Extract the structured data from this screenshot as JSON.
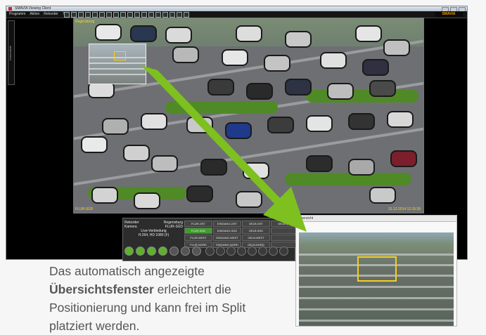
{
  "window": {
    "title": "SMAVIA Viewing Client",
    "menu": [
      "Programm",
      "Aktion",
      "Rekorder",
      "?"
    ],
    "brand": "SMAVIA",
    "side_tab": "Kameraliste"
  },
  "camera": {
    "label": "Regensburg",
    "name": "FLUR-SÜD",
    "timestamp": "31.12.2014 12:15:39"
  },
  "panel": {
    "recorder_label": "Rekorder",
    "recorder_value": "Regensburg",
    "camera_label": "Kamera",
    "camera_value": "FLUR-SÜD",
    "connection": "Live-Verbindung",
    "format": "H.264, HD 1080 (F)",
    "cameras": [
      "FLUR-OST",
      "EINGANG-OST",
      "GELB.OST",
      "GELB.OST",
      "FLUR-SÜD",
      "EINGANG-SÜD",
      "GELB.SÜD",
      "",
      "FLUR-WEST",
      "EINGANG-WEST",
      "GELB.WEST",
      "",
      "FLUR-NORD",
      "EINGANG-NORD",
      "GELB.NORD",
      ""
    ],
    "active_index": 4
  },
  "overview": {
    "title": "Übersicht"
  },
  "caption": {
    "line1": "Das automatisch angezeigte",
    "bold": "Übersichtsfenster",
    "line2_rest": " erleichtert die",
    "line3": "Positionierung und kann frei im Split",
    "line4": "platziert werden."
  },
  "colors": {
    "arrow": "#7dc01f",
    "selection": "#f4cf1f",
    "active_camera": "#3f9c2d"
  }
}
